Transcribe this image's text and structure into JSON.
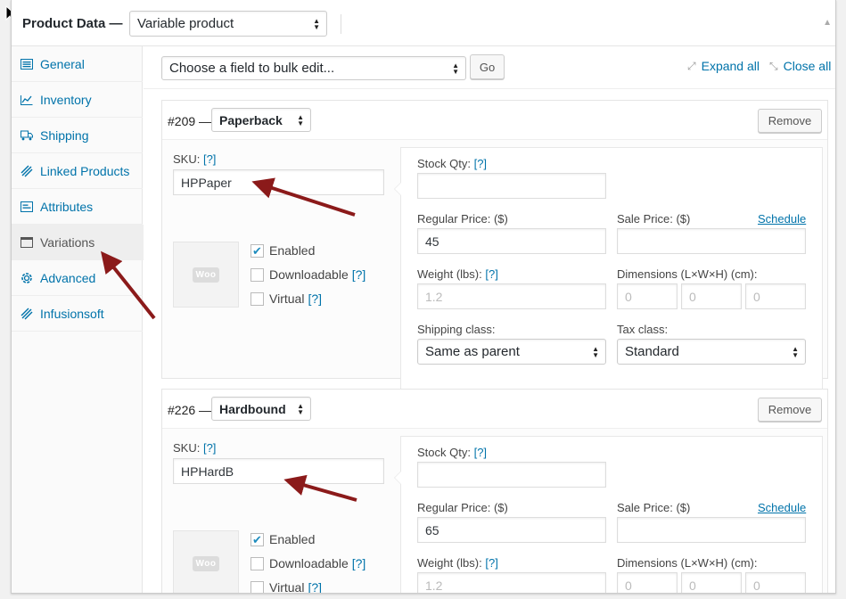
{
  "panel": {
    "title": "Product Data —",
    "product_type": "Variable product"
  },
  "sidebar": {
    "items": [
      {
        "label": "General",
        "icon": "general-icon"
      },
      {
        "label": "Inventory",
        "icon": "inventory-icon"
      },
      {
        "label": "Shipping",
        "icon": "truck-icon"
      },
      {
        "label": "Linked Products",
        "icon": "link-icon"
      },
      {
        "label": "Attributes",
        "icon": "list-icon"
      },
      {
        "label": "Variations",
        "icon": "variations-icon"
      },
      {
        "label": "Advanced",
        "icon": "gear-icon"
      },
      {
        "label": "Infusionsoft",
        "icon": "tag-icon"
      }
    ],
    "active": "Variations"
  },
  "toolbar": {
    "bulk_edit": "Choose a field to bulk edit...",
    "go_label": "Go",
    "expand_all": "Expand all",
    "close_all": "Close all"
  },
  "labels": {
    "sku": "SKU:",
    "help": "[?]",
    "stock_qty": "Stock Qty:",
    "regular_price": "Regular Price: ($)",
    "sale_price": "Sale Price: ($)",
    "schedule": "Schedule",
    "weight": "Weight (lbs):",
    "dimensions": "Dimensions (L×W×H) (cm):",
    "shipping_class": "Shipping class:",
    "tax_class": "Tax class:",
    "enabled": "Enabled",
    "downloadable": "Downloadable",
    "virtual": "Virtual",
    "remove": "Remove",
    "woo_logo": "Woo"
  },
  "variations": [
    {
      "id": "#209 —",
      "attribute": "Paperback",
      "sku": "HPPaper",
      "stock_qty": "",
      "regular_price": "45",
      "sale_price": "",
      "weight_placeholder": "1.2",
      "dimensions": [
        "0",
        "0",
        "0"
      ],
      "shipping_class": "Same as parent",
      "tax_class": "Standard",
      "enabled": true,
      "downloadable": false,
      "virtual": false
    },
    {
      "id": "#226 —",
      "attribute": "Hardbound",
      "sku": "HPHardB",
      "stock_qty": "",
      "regular_price": "65",
      "sale_price": "",
      "weight_placeholder": "1.2",
      "dimensions": [
        "0",
        "0",
        "0"
      ],
      "enabled": true,
      "downloadable": false,
      "virtual": false
    }
  ],
  "colors": {
    "link": "#0073aa",
    "arrow": "#8b1a1a"
  }
}
